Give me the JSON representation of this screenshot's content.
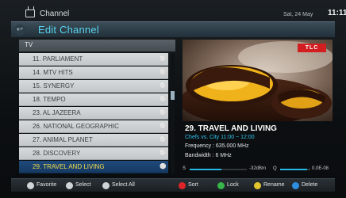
{
  "topbar": {
    "title": "Channel",
    "date": "Sat, 24 May",
    "time": "11:11",
    "icon": "tv-icon"
  },
  "header": {
    "title": "Edit Channel",
    "back_icon": "back-icon"
  },
  "group": {
    "label": "TV"
  },
  "channels": [
    {
      "name": "11. PARLIAMENT",
      "locked": true
    },
    {
      "name": "14. MTV HITS",
      "locked": true
    },
    {
      "name": "15. SYNERGY",
      "locked": true
    },
    {
      "name": "18. TEMPO",
      "locked": true
    },
    {
      "name": "23. AL JAZEERA",
      "locked": true
    },
    {
      "name": "26. NATIONAL GEOGRAPHIC",
      "locked": true
    },
    {
      "name": "27. ANIMAL PLANET",
      "locked": true
    },
    {
      "name": "28. DISCOVERY",
      "locked": true
    },
    {
      "name": "29. TRAVEL AND LIVING",
      "locked": true,
      "selected": true
    }
  ],
  "info": {
    "logo": "TLC",
    "title": "29. TRAVEL AND LIVING",
    "program": "Chefs vs. City 11:00 ~ 12:00",
    "frequency": "Frequency : 635.000 MHz",
    "bandwidth": "Bandwidth : 6 MHz"
  },
  "signal": {
    "strength_label": "S",
    "strength_value": "-32dBm",
    "strength_fraction": 0.55,
    "quality_label": "Q",
    "quality_value": "0.0E-08",
    "quality_fraction": 0.9
  },
  "bottombar": {
    "favorite": "Favorite",
    "select": "Select",
    "select_all": "Select All",
    "sort": "Sort",
    "lock": "Lock",
    "rename": "Rename",
    "delete": "Delete"
  },
  "colors": {
    "accent": "#57d4ee",
    "selected_row": "#1f4a7c",
    "selected_text": "#f4de4a",
    "logo_red": "#d21e20"
  }
}
